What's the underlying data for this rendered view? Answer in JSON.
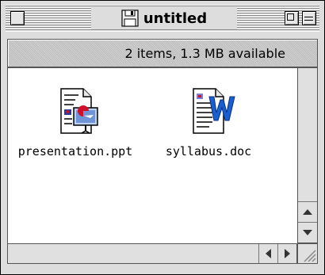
{
  "window": {
    "title": "untitled",
    "title_icon": "floppy-disk-icon",
    "status": "2 items, 1.3 MB available"
  },
  "files": [
    {
      "name": "presentation.ppt",
      "icon": "powerpoint-document-icon"
    },
    {
      "name": "syllabus.doc",
      "icon": "word-document-icon"
    }
  ],
  "colors": {
    "content_background": "#ffffff",
    "chrome_gray": "#dddddd",
    "word_blue": "#1a5fd0",
    "ppt_red": "#d0102a"
  }
}
